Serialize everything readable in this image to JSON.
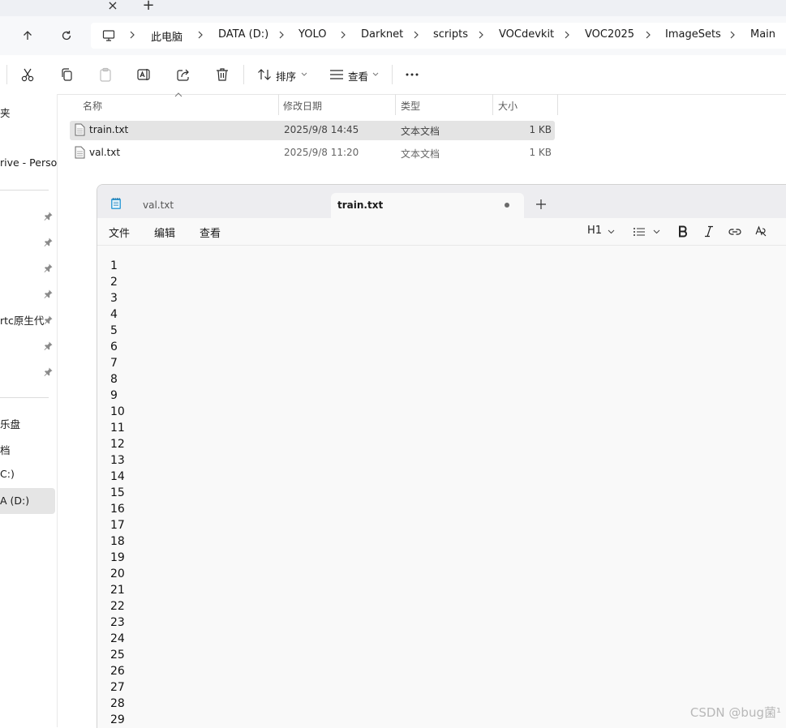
{
  "explorer": {
    "tab_close_symbol": "×",
    "tab_new_symbol": "+",
    "breadcrumbs": [
      "此电脑",
      "DATA (D:)",
      "YOLO",
      "Darknet",
      "scripts",
      "VOCdevkit",
      "VOC2025",
      "ImageSets",
      "Main"
    ],
    "commands": {
      "sort_label": "排序",
      "view_label": "查看"
    },
    "nav": {
      "items": [
        "夹",
        "rive - Perso",
        "rtc原生代",
        "乐盘",
        "档",
        "C:)",
        "A (D:)"
      ]
    },
    "columns": {
      "name": "名称",
      "modified": "修改日期",
      "type": "类型",
      "size": "大小"
    },
    "files": [
      {
        "name": "train.txt",
        "modified": "2025/9/8 14:45",
        "type": "文本文档",
        "size": "1 KB",
        "selected": true
      },
      {
        "name": "val.txt",
        "modified": "2025/9/8 11:20",
        "type": "文本文档",
        "size": "1 KB",
        "selected": false
      }
    ]
  },
  "notepad": {
    "tabs": [
      {
        "label": "val.txt",
        "active": false
      },
      {
        "label": "train.txt",
        "active": true,
        "unsaved": true
      }
    ],
    "menu": {
      "file": "文件",
      "edit": "编辑",
      "view": "查看"
    },
    "toolbar": {
      "heading": "H1"
    },
    "lines": [
      "1",
      "2",
      "3",
      "4",
      "5",
      "6",
      "7",
      "8",
      "9",
      "10",
      "11",
      "12",
      "13",
      "14",
      "15",
      "16",
      "17",
      "18",
      "19",
      "20",
      "21",
      "22",
      "23",
      "24",
      "25",
      "26",
      "27",
      "28",
      "29"
    ]
  },
  "watermark": "CSDN @bug菌¹",
  "colors": {
    "selection": "#e4e4e4",
    "notepad_bg": "#f9f9f9",
    "accent": "#0078d4"
  }
}
